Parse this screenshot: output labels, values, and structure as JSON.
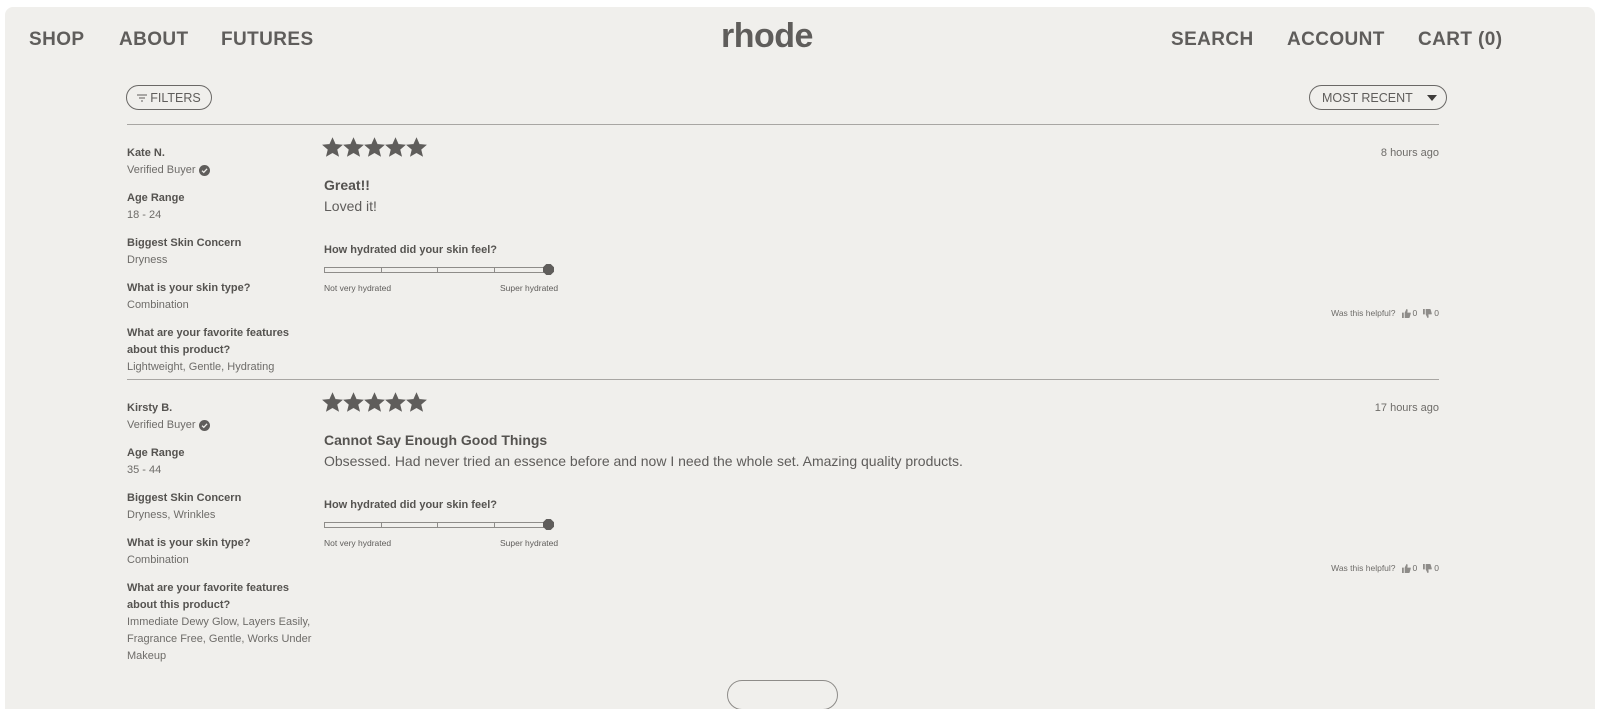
{
  "header": {
    "nav_left": [
      "SHOP",
      "ABOUT",
      "FUTURES"
    ],
    "logo": "rhode",
    "nav_right": [
      "SEARCH",
      "ACCOUNT",
      "CART (0)"
    ]
  },
  "toolbar": {
    "filters_label": "FILTERS",
    "sort_label": "MOST RECENT"
  },
  "reviews": [
    {
      "name": "Kate N.",
      "verified": "Verified Buyer",
      "rating": 5,
      "date": "8 hours ago",
      "title": "Great!!",
      "body": "Loved it!",
      "attributes": [
        {
          "label": "Age Range",
          "value": "18 - 24"
        },
        {
          "label": "Biggest Skin Concern",
          "value": "Dryness"
        },
        {
          "label": "What is your skin type?",
          "value": "Combination"
        },
        {
          "label": "What are your favorite features about this product?",
          "value": "Lightweight, Gentle, Hydrating"
        }
      ],
      "question": "How hydrated did your skin feel?",
      "scale_min": "Not very hydrated",
      "scale_max": "Super hydrated",
      "scale_value": 1.0,
      "helpful_label": "Was this helpful?",
      "helpful_yes": "0",
      "helpful_no": "0"
    },
    {
      "name": "Kirsty B.",
      "verified": "Verified Buyer",
      "rating": 5,
      "date": "17 hours ago",
      "title": "Cannot Say Enough Good Things",
      "body": "Obsessed. Had never tried an essence before and now I need the whole set. Amazing quality products.",
      "attributes": [
        {
          "label": "Age Range",
          "value": "35 - 44"
        },
        {
          "label": "Biggest Skin Concern",
          "value": "Dryness, Wrinkles"
        },
        {
          "label": "What is your skin type?",
          "value": "Combination"
        },
        {
          "label": "What are your favorite features about this product?",
          "value": "Immediate Dewy Glow, Layers Easily, Fragrance Free, Gentle, Works Under Makeup"
        }
      ],
      "question": "How hydrated did your skin feel?",
      "scale_min": "Not very hydrated",
      "scale_max": "Super hydrated",
      "scale_value": 1.0,
      "helpful_label": "Was this helpful?",
      "helpful_yes": "0",
      "helpful_no": "0"
    }
  ],
  "colors": {
    "background": "#f0efec",
    "text": "#5f5d5b",
    "star": "#5f5d5b"
  }
}
